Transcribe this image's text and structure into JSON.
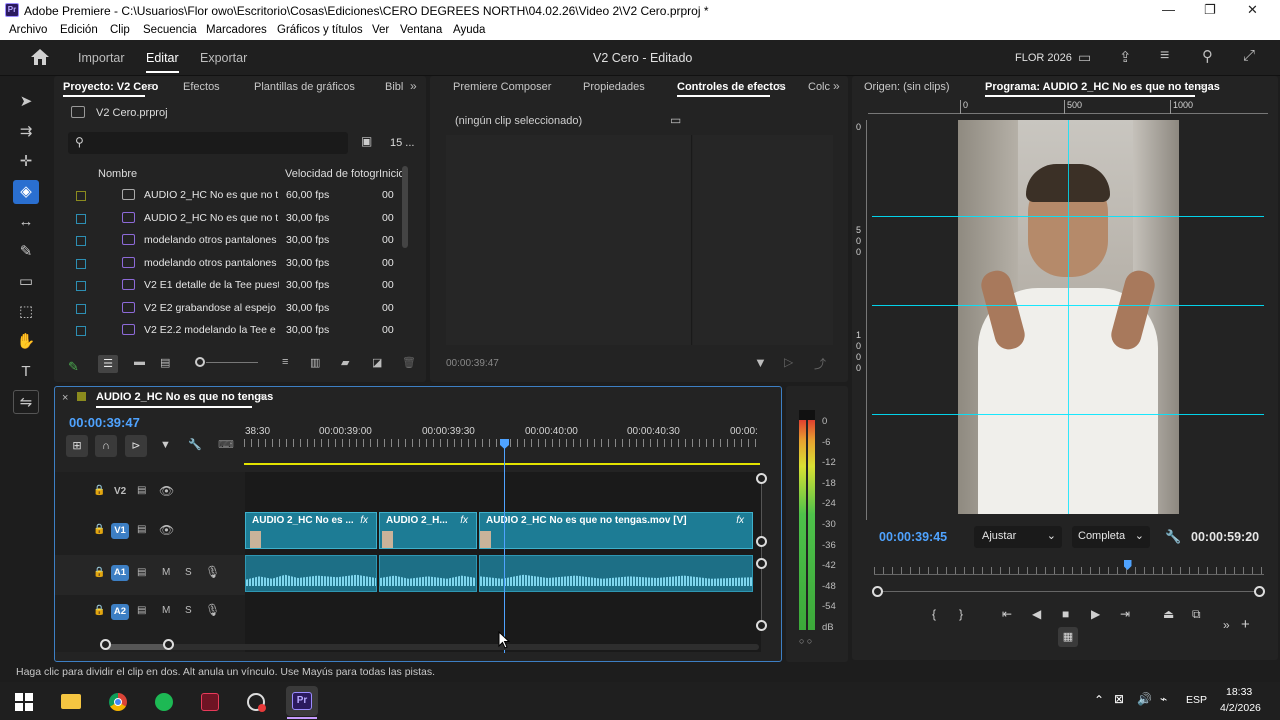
{
  "titlebar": {
    "app_icon": "Pr",
    "title": "Adobe Premiere - C:\\Usuarios\\Flor owo\\Escritorio\\Cosas\\Ediciones\\CERO DEGREES NORTH\\04.02.26\\Video 2\\V2 Cero.prproj *",
    "minimize": "—",
    "restore": "❐",
    "close": "✕"
  },
  "menu": [
    "Archivo",
    "Edición",
    "Clip",
    "Secuencia",
    "Marcadores",
    "Gráficos y títulos",
    "Ver",
    "Ventana",
    "Ayuda"
  ],
  "header": {
    "workspaces": [
      "Importar",
      "Editar",
      "Exportar"
    ],
    "active_workspace": "Editar",
    "doc_title": "V2 Cero - Editado",
    "user": "FLOR 2026"
  },
  "project_panel": {
    "tabs": [
      "Proyecto: V2 Cero",
      "Efectos",
      "Plantillas de gráficos",
      "Bibl"
    ],
    "file": "V2 Cero.prproj",
    "item_count": "15 ...",
    "columns": [
      "Nombre",
      "Velocidad de fotogr",
      "Inicio"
    ],
    "rows": [
      {
        "name": "AUDIO 2_HC No es que no t",
        "fps": "60,00 fps",
        "start": "00",
        "color": "#8b8b1e",
        "type": "seq"
      },
      {
        "name": "AUDIO 2_HC No es que no t",
        "fps": "30,00 fps",
        "start": "00",
        "color": "#2d8fb3",
        "type": "clip"
      },
      {
        "name": "modelando otros pantalones",
        "fps": "30,00 fps",
        "start": "00",
        "color": "#2d8fb3",
        "type": "clip"
      },
      {
        "name": "modelando otros pantalones",
        "fps": "30,00 fps",
        "start": "00",
        "color": "#2d8fb3",
        "type": "clip"
      },
      {
        "name": "V2 E1 detalle de la Tee puest",
        "fps": "30,00 fps",
        "start": "00",
        "color": "#2d8fb3",
        "type": "clip"
      },
      {
        "name": "V2 E2 grabandose al espejo c",
        "fps": "30,00 fps",
        "start": "00",
        "color": "#2d8fb3",
        "type": "clip"
      },
      {
        "name": "V2 E2.2 modelando la Tee e",
        "fps": "30,00 fps",
        "start": "00",
        "color": "#2d8fb3",
        "type": "clip"
      }
    ]
  },
  "effects_panel": {
    "tabs": [
      "Premiere Composer",
      "Propiedades",
      "Controles de efectos",
      "Colc"
    ],
    "empty_message": "(ningún clip seleccionado)",
    "timecode": "00:00:39:47"
  },
  "program_monitor": {
    "tabs": [
      "Origen: (sin clips)",
      "Programa: AUDIO 2_HC No es que no tengas"
    ],
    "ruler_labels": [
      "0",
      "500",
      "1000"
    ],
    "side_ruler": [
      "0",
      "5",
      "0",
      "0",
      "1",
      "0",
      "0",
      "0"
    ],
    "current_time": "00:00:39:45",
    "fit": "Ajustar",
    "quality": "Completa",
    "duration": "00:00:59:20",
    "playhead_fraction": 0.65
  },
  "timeline": {
    "sequence_name": "AUDIO 2_HC No es que no tengas",
    "timecode": "00:00:39:47",
    "ruler_labels": [
      "38:30",
      "00:00:39:00",
      "00:00:39:30",
      "00:00:40:00",
      "00:00:40:30",
      "00:00:"
    ],
    "tracks": [
      {
        "id": "V2",
        "kind": "video"
      },
      {
        "id": "V1",
        "kind": "video"
      },
      {
        "id": "A1",
        "kind": "audio"
      },
      {
        "id": "A2",
        "kind": "audio"
      }
    ],
    "track_mute": "M",
    "track_solo": "S",
    "video_clips": [
      "AUDIO 2_HC No es ...",
      "AUDIO 2_H...",
      "AUDIO 2_HC No es que no tengas.mov [V]"
    ],
    "fx_label": "fx"
  },
  "audio_meter": {
    "scale": [
      "0",
      "-6",
      "-12",
      "-18",
      "-24",
      "-30",
      "-36",
      "-42",
      "-48",
      "-54",
      "dB"
    ],
    "peaks": "○ ○"
  },
  "status_bar": {
    "text": "Haga clic para dividir el clip en dos. Alt anula un vínculo. Use Mayús para todas las pistas."
  },
  "taskbar": {
    "lang": "ESP",
    "time": "18:33",
    "date": "4/2/2026",
    "apps": [
      "windows-start",
      "file-explorer",
      "chrome",
      "spotify",
      "app-red",
      "app-speed",
      "premiere"
    ],
    "premiere_label": "Pr"
  }
}
